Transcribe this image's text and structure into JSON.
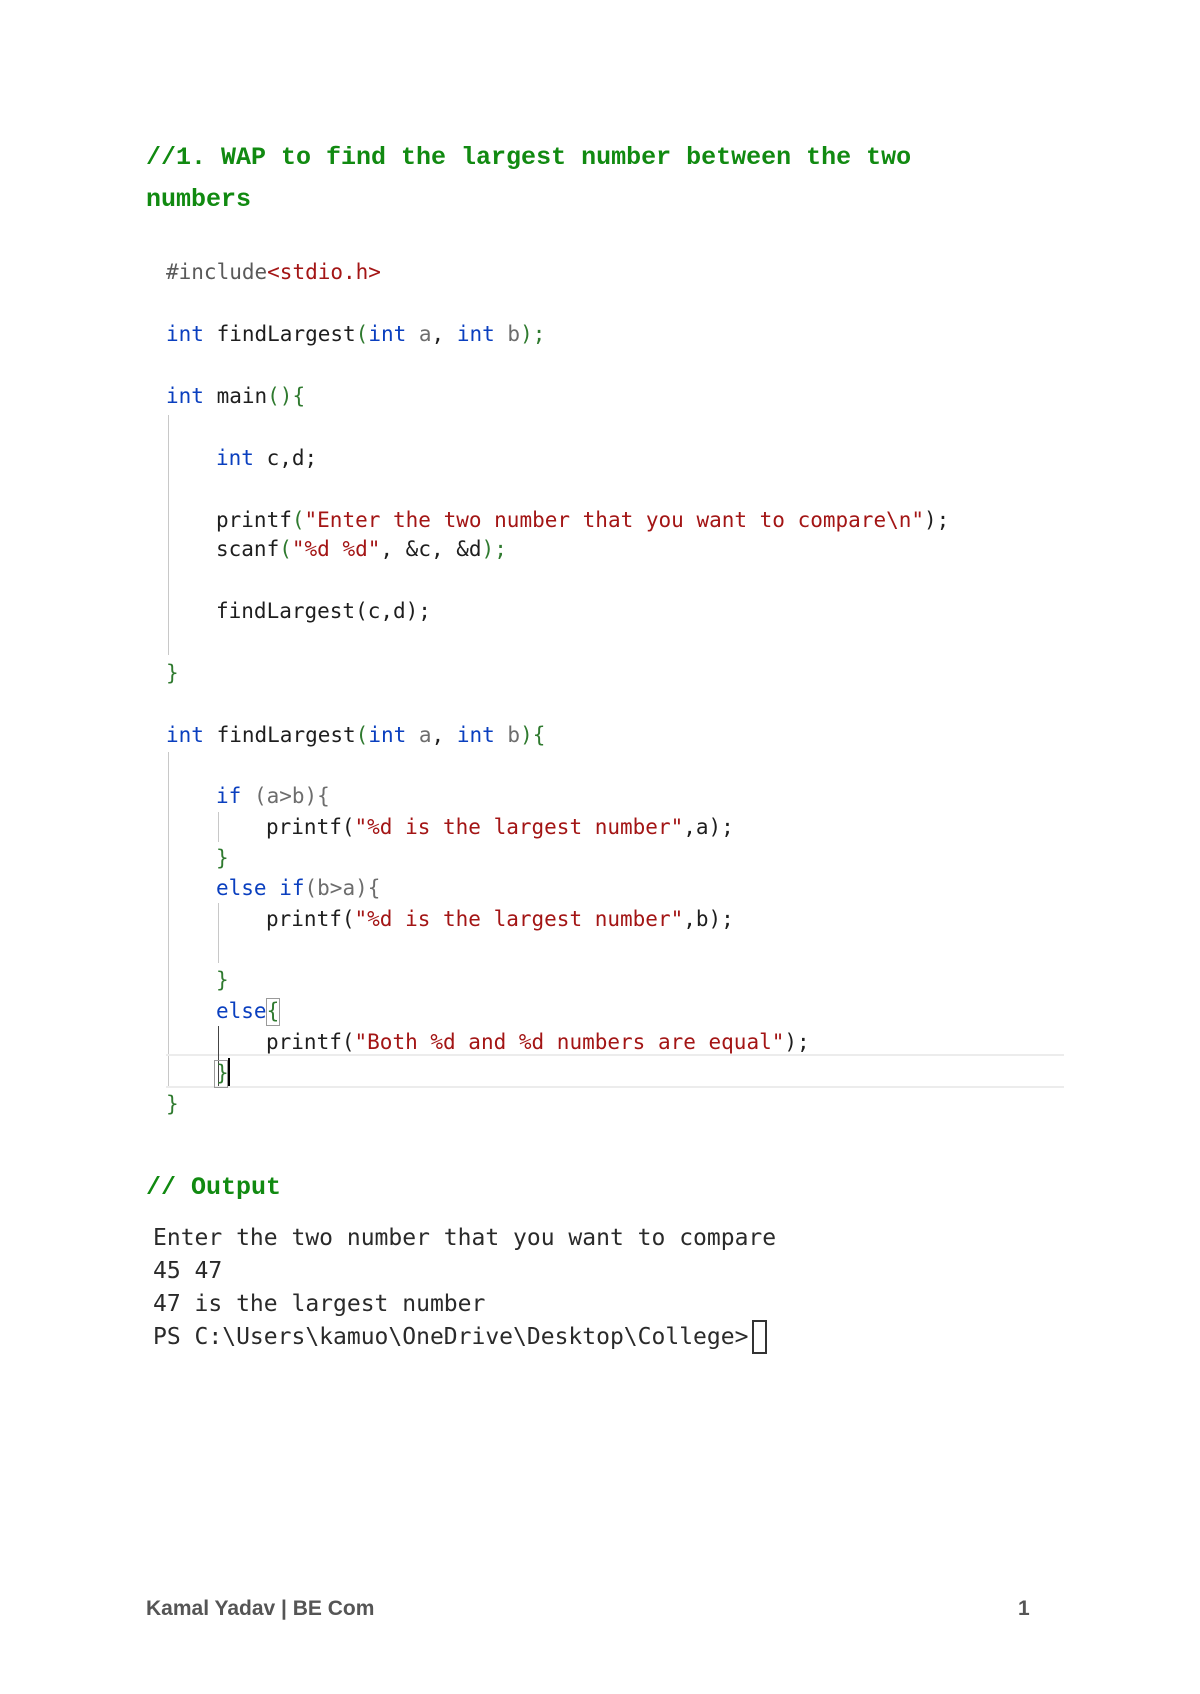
{
  "heading": {
    "line1": "//1. WAP to find the largest number between the two",
    "line2": "numbers"
  },
  "code": {
    "include_directive": "#include",
    "include_header": "<stdio.h>",
    "lines": {
      "proto_type": "int",
      "proto_name": " findLargest",
      "proto_open": "(",
      "proto_int1": "int",
      "proto_a": " a",
      "proto_comma": ", ",
      "proto_int2": "int",
      "proto_b": " b",
      "proto_close": ");",
      "main_type": "int",
      "main_name": " main",
      "main_parens": "(){",
      "decl_type": "int",
      "decl_vars": " c,d;",
      "printf1_fn": "printf",
      "printf1_open": "(",
      "printf1_str": "\"Enter the two number that you want to compare\\n\"",
      "printf1_close": ");",
      "scanf_fn": "scanf",
      "scanf_open": "(",
      "scanf_str": "\"%d %d\"",
      "scanf_args": ", &c, &d",
      "scanf_close": ");",
      "call": "findLargest(c,d);",
      "main_close": "}",
      "def_type": "int",
      "def_name": " findLargest",
      "def_open": "(",
      "def_int1": "int",
      "def_a": " a",
      "def_comma": ", ",
      "def_int2": "int",
      "def_b": " b",
      "def_close": "){",
      "if_kw": "if",
      "if_cond": " (a>b){",
      "printf_a_fn": "printf(",
      "printf_a_str": "\"%d is the largest number\"",
      "printf_a_end": ",a);",
      "close1": "}",
      "elseif_kw1": "else",
      "elseif_kw2": " if",
      "elseif_cond": "(b>a){",
      "printf_b_fn": "printf(",
      "printf_b_str": "\"%d is the largest number\"",
      "printf_b_end": ",b);",
      "close2": "}",
      "else_kw": "else",
      "else_brace": "{",
      "printf_c_fn": "printf(",
      "printf_c_str": "\"Both %d and %d numbers are equal\"",
      "printf_c_end": ");",
      "close3": "}",
      "func_close": "}"
    }
  },
  "output_heading": "// Output",
  "terminal": {
    "lines": [
      "Enter the two number that you want to compare",
      "45 47",
      "47 is the largest number",
      "PS C:\\Users\\kamuo\\OneDrive\\Desktop\\College> "
    ]
  },
  "footer": {
    "author": "Kamal Yadav | BE Com",
    "page_number": "1"
  }
}
